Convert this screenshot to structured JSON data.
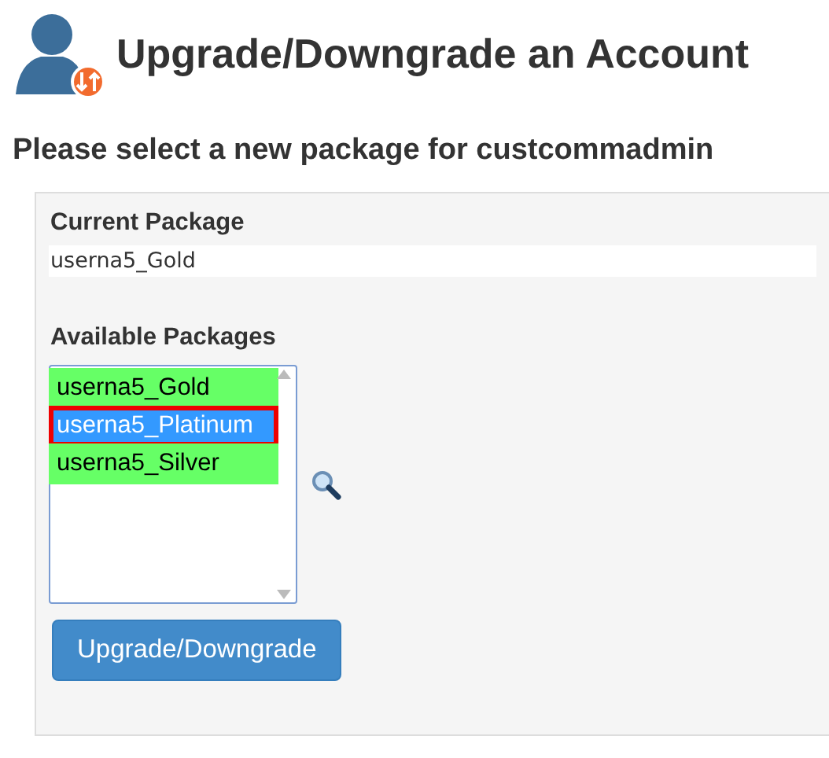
{
  "title": "Upgrade/Downgrade an Account",
  "subtitle": "Please select a new package for custcommadmin",
  "current_package": {
    "label": "Current Package",
    "value": "userna5_Gold"
  },
  "available_packages": {
    "label": "Available Packages",
    "options": [
      {
        "label": "userna5_Gold",
        "selected": false,
        "color": "#66ff66"
      },
      {
        "label": "userna5_Platinum",
        "selected": true
      },
      {
        "label": "userna5_Silver",
        "selected": false,
        "color": "#66ff66"
      }
    ]
  },
  "button": "Upgrade/Downgrade"
}
